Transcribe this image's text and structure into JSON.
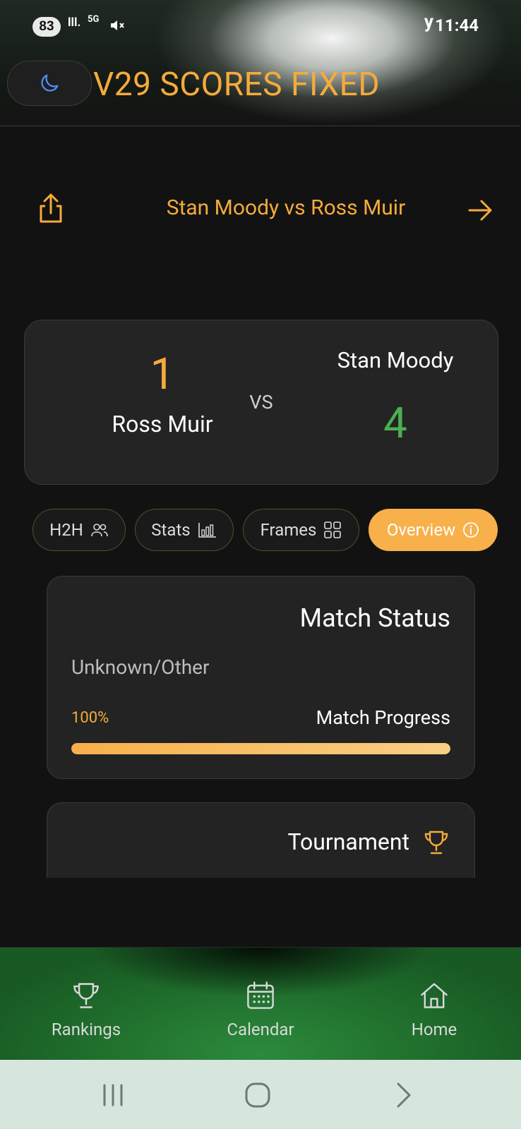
{
  "status_bar": {
    "battery": "83",
    "signal": "lll.",
    "network": "5G",
    "carrier": "y",
    "time": "11:44"
  },
  "header": {
    "theme_toggle_icon": "moon-icon",
    "app_title": "V29 SCORES FIXED"
  },
  "match": {
    "title": "Stan Moody vs Ross Muir",
    "share_icon": "share-icon",
    "next_icon": "arrow-right-icon"
  },
  "score_card": {
    "left_player": "Ross Muir",
    "left_score": "1",
    "vs": "VS",
    "right_player": "Stan Moody",
    "right_score": "4",
    "colors": {
      "left_score": "#f5ab3c",
      "right_score": "#4caf50"
    }
  },
  "tabs": [
    {
      "label": "H2H",
      "icon": "people-icon",
      "active": false
    },
    {
      "label": "Stats",
      "icon": "bar-chart-icon",
      "active": false
    },
    {
      "label": "Frames",
      "icon": "grid-icon",
      "active": false
    },
    {
      "label": "Overview",
      "icon": "info-icon",
      "active": true
    }
  ],
  "status_card": {
    "title": "Match Status",
    "value": "Unknown/Other",
    "progress_percent_label": "100%",
    "progress_label": "Match Progress",
    "progress_value": 1.0
  },
  "tournament_card": {
    "title": "Tournament",
    "icon": "trophy-icon"
  },
  "bottom_nav": [
    {
      "label": "Rankings",
      "icon": "trophy-icon"
    },
    {
      "label": "Calendar",
      "icon": "calendar-icon"
    },
    {
      "label": "Home",
      "icon": "home-icon"
    }
  ],
  "accent_color": "#f5ab3c"
}
